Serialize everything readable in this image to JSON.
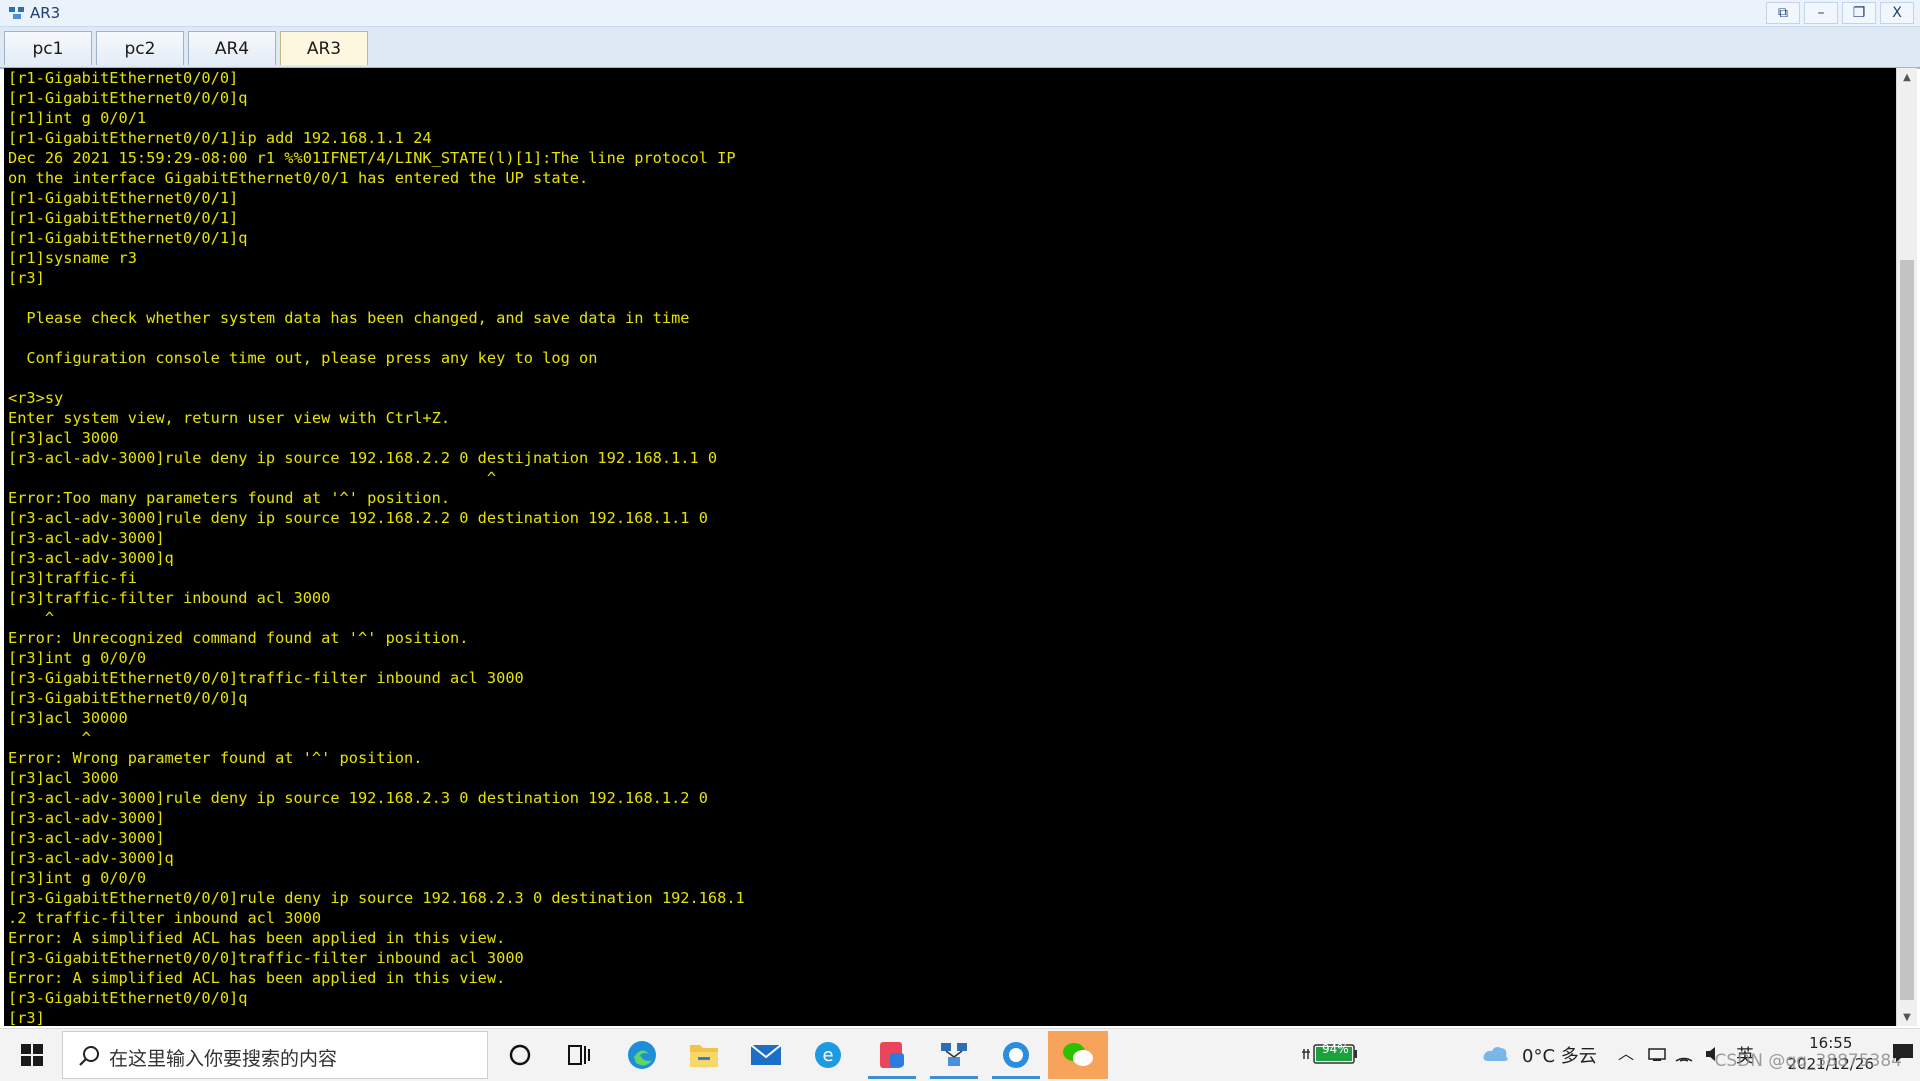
{
  "window": {
    "title": "AR3",
    "controls": {
      "restore_extra": "⧉",
      "minimize": "–",
      "maximize": "❐",
      "close": "X"
    }
  },
  "tabs": [
    {
      "label": "pc1",
      "active": false
    },
    {
      "label": "pc2",
      "active": false
    },
    {
      "label": "AR4",
      "active": false
    },
    {
      "label": "AR3",
      "active": true
    }
  ],
  "terminal": {
    "text_color": "#e4e400",
    "lines": [
      "[r1-GigabitEthernet0/0/0]",
      "[r1-GigabitEthernet0/0/0]q",
      "[r1]int g 0/0/1",
      "[r1-GigabitEthernet0/0/1]ip add 192.168.1.1 24",
      "Dec 26 2021 15:59:29-08:00 r1 %%01IFNET/4/LINK_STATE(l)[1]:The line protocol IP",
      "on the interface GigabitEthernet0/0/1 has entered the UP state.",
      "[r1-GigabitEthernet0/0/1]",
      "[r1-GigabitEthernet0/0/1]",
      "[r1-GigabitEthernet0/0/1]q",
      "[r1]sysname r3",
      "[r3]",
      "",
      "  Please check whether system data has been changed, and save data in time",
      "",
      "  Configuration console time out, please press any key to log on",
      "",
      "<r3>sy",
      "Enter system view, return user view with Ctrl+Z.",
      "[r3]acl 3000",
      "[r3-acl-adv-3000]rule deny ip source 192.168.2.2 0 destijnation 192.168.1.1 0",
      "                                                    ^",
      "Error:Too many parameters found at '^' position.",
      "[r3-acl-adv-3000]rule deny ip source 192.168.2.2 0 destination 192.168.1.1 0",
      "[r3-acl-adv-3000]",
      "[r3-acl-adv-3000]q",
      "[r3]traffic-fi",
      "[r3]traffic-filter inbound acl 3000",
      "    ^",
      "Error: Unrecognized command found at '^' position.",
      "[r3]int g 0/0/0",
      "[r3-GigabitEthernet0/0/0]traffic-filter inbound acl 3000",
      "[r3-GigabitEthernet0/0/0]q",
      "[r3]acl 30000",
      "        ^",
      "Error: Wrong parameter found at '^' position.",
      "[r3]acl 3000",
      "[r3-acl-adv-3000]rule deny ip source 192.168.2.3 0 destination 192.168.1.2 0",
      "[r3-acl-adv-3000]",
      "[r3-acl-adv-3000]",
      "[r3-acl-adv-3000]q",
      "[r3]int g 0/0/0",
      "[r3-GigabitEthernet0/0/0]rule deny ip source 192.168.2.3 0 destination 192.168.1",
      ".2 traffic-filter inbound acl 3000",
      "Error: A simplified ACL has been applied in this view.",
      "[r3-GigabitEthernet0/0/0]traffic-filter inbound acl 3000",
      "Error: A simplified ACL has been applied in this view.",
      "[r3-GigabitEthernet0/0/0]q",
      "[r3]"
    ]
  },
  "taskbar": {
    "search_placeholder": "在这里输入你要搜索的内容",
    "apps": [
      "cortana-icon",
      "task-view-icon",
      "edge-icon",
      "file-explorer-icon",
      "mail-icon",
      "ie-icon",
      "media-app-icon",
      "ensp-icon",
      "browser-app-icon",
      "wechat-icon"
    ],
    "battery_percent": "94%",
    "weather": "0°C 多云",
    "ime": "英",
    "time": "16:55",
    "date": "2021/12/26",
    "watermark": "CSDN @qq_38875384"
  }
}
